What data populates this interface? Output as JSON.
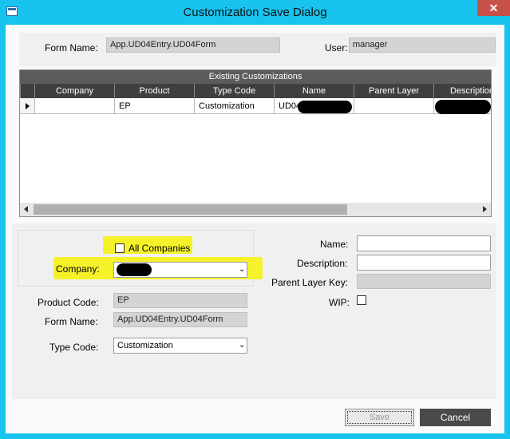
{
  "window": {
    "title": "Customization Save Dialog",
    "close_glyph": "✕",
    "app_icon": "window-icon"
  },
  "top": {
    "form_name_label": "Form Name:",
    "form_name_value": "App.UD04Entry.UD04Form",
    "user_label": "User:",
    "user_value": "manager"
  },
  "grid": {
    "caption": "Existing Customizations",
    "columns": [
      "Company",
      "Product",
      "Type Code",
      "Name",
      "Parent Layer",
      "Description"
    ],
    "rows": [
      {
        "company": "",
        "product": "EP",
        "type_code": "Customization",
        "name": "UD04",
        "parent_layer": "",
        "description": ""
      }
    ]
  },
  "form": {
    "all_companies_label": "All Companies",
    "all_companies_checked": false,
    "company_label": "Company:",
    "product_code_label": "Product Code:",
    "product_code_value": "EP",
    "form_name_label": "Form Name:",
    "form_name_value": "App.UD04Entry.UD04Form",
    "type_code_label": "Type Code:",
    "type_code_value": "Customization",
    "name_label": "Name:",
    "description_label": "Description:",
    "parent_layer_key_label": "Parent Layer Key:",
    "wip_label": "WIP:",
    "wip_checked": false
  },
  "buttons": {
    "save": "Save",
    "cancel": "Cancel"
  },
  "colors": {
    "titlebar": "#18c3ee",
    "close": "#c7504b",
    "highlight": "#f5f22a",
    "grid_header": "#3f3f3f"
  }
}
